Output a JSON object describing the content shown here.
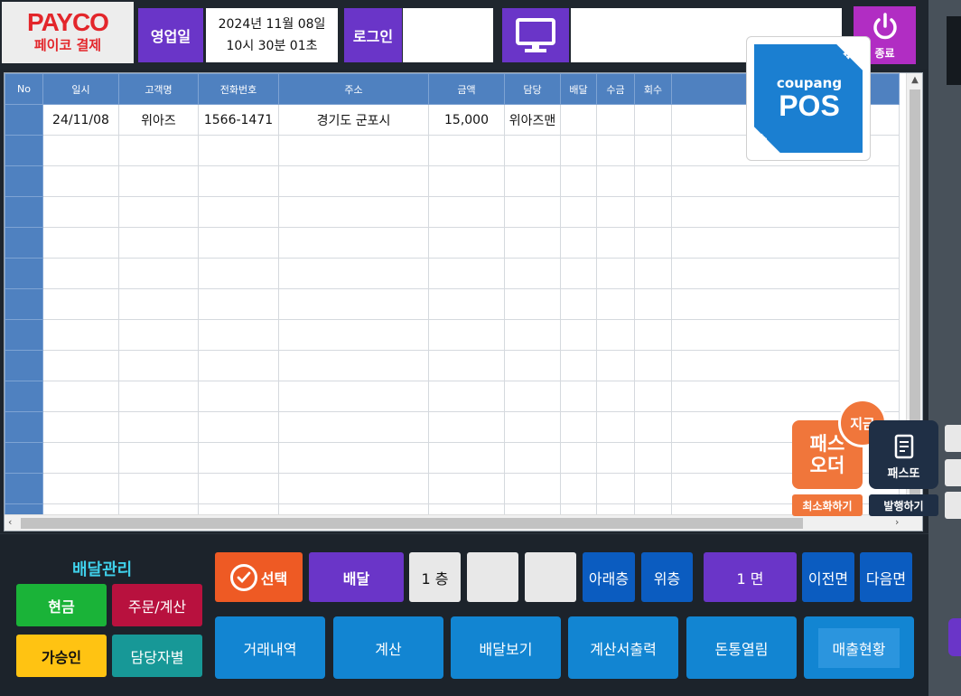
{
  "header": {
    "payco_logo": "PAYCO",
    "payco_sub": "페이코 결제",
    "business_day_label": "영업일",
    "date_line1": "2024년 11월 08일",
    "date_line2": "10시 30분 01초",
    "login_label": "로그인",
    "login_value": "",
    "info_value": "",
    "exit_label": "종료"
  },
  "table": {
    "columns": [
      "No",
      "일시",
      "고객명",
      "전화번호",
      "주소",
      "금액",
      "담당",
      "배달",
      "수금",
      "회수",
      ""
    ],
    "rows": [
      [
        "",
        "24/11/08",
        "위아즈",
        "1566-1471",
        "경기도 군포시",
        "15,000",
        "위아즈맨",
        "",
        "",
        "",
        ""
      ]
    ]
  },
  "coupang": {
    "line1": "coupang",
    "line2": "POS"
  },
  "pass_order": {
    "badge": "지금",
    "title_line1": "패스",
    "title_line2": "오더",
    "minimize": "최소화하기",
    "passto": "패스또",
    "issue": "발행하기"
  },
  "bottom": {
    "title": "배달관리",
    "cash": "현금",
    "order_calc": "주문/계산",
    "approval": "가승인",
    "by_staff": "담당자별",
    "select": "선택",
    "delivery": "배달",
    "floor": "1 층",
    "lower_floor": "아래층",
    "upper_floor": "위층",
    "page": "1 면",
    "prev_page": "이전면",
    "next_page": "다음면",
    "history": "거래내역",
    "calc": "계산",
    "view_delivery": "배달보기",
    "print_invoice": "계산서출력",
    "open_drawer": "돈통열림",
    "sales_status": "매출현황"
  }
}
